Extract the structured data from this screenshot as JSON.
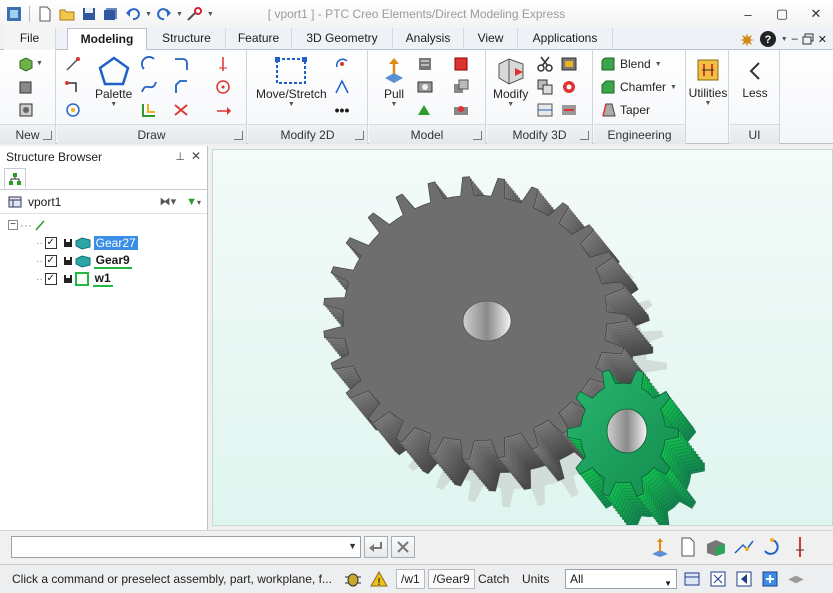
{
  "window": {
    "title": "[ vport1 ] - PTC Creo Elements/Direct Modeling Express",
    "controls": [
      "–",
      "▢",
      "✕"
    ]
  },
  "ribbon_tabs": [
    "File",
    "Modeling",
    "Structure",
    "Feature",
    "3D Geometry",
    "Analysis",
    "View",
    "Applications"
  ],
  "ribbon": {
    "groups": {
      "new": "New",
      "draw": "Draw",
      "modify2d": "Modify 2D",
      "model": "Model",
      "modify3d": "Modify 3D",
      "engineering": "Engineering",
      "ui": "UI"
    },
    "buttons": {
      "palette": "Palette",
      "move_stretch": "Move/Stretch",
      "pull": "Pull",
      "modify": "Modify",
      "blend": "Blend",
      "chamfer": "Chamfer",
      "taper": "Taper",
      "utilities": "Utilities",
      "less": "Less"
    }
  },
  "structure_browser": {
    "title": "Structure Browser",
    "viewport": "vport1",
    "items": [
      {
        "name": "Gear27",
        "selected": true
      },
      {
        "name": "Gear9",
        "selected": false
      },
      {
        "name": "w1",
        "selected": false
      }
    ]
  },
  "statusbar": {
    "message": "Click a command or preselect assembly, part, workplane, f...",
    "workplane": "/w1",
    "part": "/Gear9",
    "catch": "Catch",
    "units": "Units",
    "filter": "All"
  },
  "colors": {
    "gear_large": "#6e6e6e",
    "gear_small": "#1fa060",
    "selected": "#3a8ee6",
    "viewport_bg": "#e6f7f2"
  }
}
